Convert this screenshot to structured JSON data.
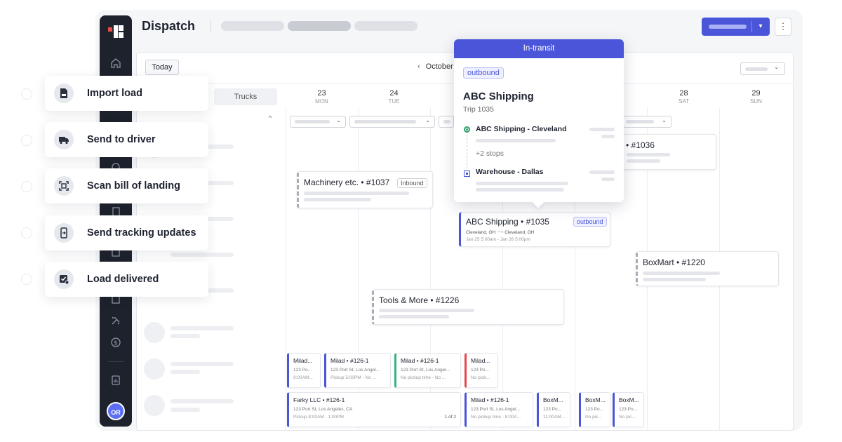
{
  "header": {
    "title": "Dispatch"
  },
  "calendar": {
    "today_label": "Today",
    "month_label": "October",
    "trucks_tab": "Trucks",
    "days": [
      {
        "num": "23",
        "dow": "MON"
      },
      {
        "num": "24",
        "dow": "TUE"
      },
      {
        "num": "",
        "dow": ""
      },
      {
        "num": "",
        "dow": ""
      },
      {
        "num": "",
        "dow": ""
      },
      {
        "num": "28",
        "dow": "SAT"
      },
      {
        "num": "29",
        "dow": "SUN"
      }
    ]
  },
  "loads": {
    "machinery": {
      "title": "Machinery etc. • #1037",
      "tag": "Inbound"
    },
    "abc": {
      "title": "ABC Shipping • #1035",
      "tag": "outbound",
      "route_from": "Cleveland, OH",
      "route_arrow": "⟶",
      "route_to": "Cleveland, OH",
      "times": "Jan 25 5:00am - Jan 26 5:00pm"
    },
    "load1036": {
      "title": "• #1036"
    },
    "boxmart": {
      "title": "BoxMart • #1220"
    },
    "tools": {
      "title": "Tools & More • #1226"
    }
  },
  "mini_cards": [
    {
      "title": "Milad...",
      "line1": "123 Po...",
      "line2": "9:00AM...",
      "color": "blue"
    },
    {
      "title": "Milad • #126-1",
      "line1": "123 Port St, Los Angel...",
      "line2": "Pickup 5:00PM - No ...",
      "color": "blue"
    },
    {
      "title": "Milad • #126-1",
      "line1": "123 Port St, Los Angel...",
      "line2": "No pickup time - No ...",
      "color": "green"
    },
    {
      "title": "Milad...",
      "line1": "123 Po...",
      "line2": "No pick...",
      "color": "red"
    },
    {
      "title": "Farky LLC • #126-1",
      "line1": "123 Port St, Los Angeles, CA",
      "line2": "Pickup 8:00AM - 1:00PM",
      "page": "1 of 2",
      "color": "blue"
    },
    {
      "title": "Milad • #126-1",
      "line1": "123 Port St, Los Angel...",
      "line2": "No pickup time - 8:00A...",
      "color": "blue"
    },
    {
      "title": "BoxM...",
      "line1": "123 Po...",
      "line2": "11:00AM...",
      "color": "blue"
    },
    {
      "title": "BoxM...",
      "line1": "123 Po...",
      "line2": "No pic...",
      "color": "blue"
    },
    {
      "title": "BoxM...",
      "line1": "123 Po...",
      "line2": "No pic...",
      "color": "blue"
    }
  ],
  "popover": {
    "status": "In-transit",
    "tag": "outbound",
    "company": "ABC Shipping",
    "trip": "Trip 1035",
    "origin": "ABC Shipping - Cleveland",
    "extra_stops": "+2 stops",
    "destination": "Warehouse - Dallas"
  },
  "actions": [
    {
      "label": "Import load",
      "icon": "import-file-icon"
    },
    {
      "label": "Send to driver",
      "icon": "truck-icon"
    },
    {
      "label": "Scan bill of landing",
      "icon": "scan-icon"
    },
    {
      "label": "Send tracking updates",
      "icon": "phone-update-icon"
    },
    {
      "label": "Load delivered",
      "icon": "delivered-check-icon"
    }
  ],
  "user": {
    "initials": "OR"
  },
  "colors": {
    "primary": "#4a55d9",
    "sidebar": "#1e222c",
    "green": "#36b37e",
    "red": "#e5484d"
  }
}
